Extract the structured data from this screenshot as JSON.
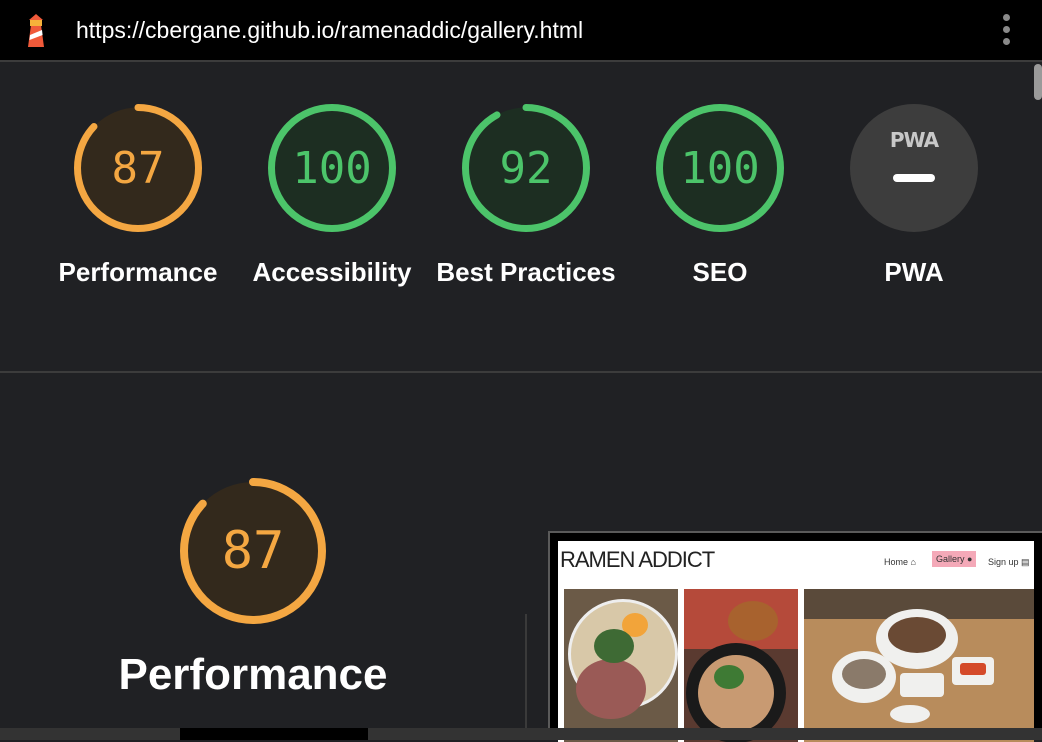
{
  "browser": {
    "url": "https://cbergane.github.io/ramenaddic/gallery.html",
    "logo_icon": "lighthouse-icon",
    "menu_icon": "kebab-menu-icon"
  },
  "colors": {
    "average": "#f4a742",
    "pass": "#4cc46a",
    "pwa_gray": "#3d3d3d",
    "background": "#202124"
  },
  "categories": [
    {
      "name": "Performance",
      "score": "87",
      "fraction": 0.87,
      "status": "average"
    },
    {
      "name": "Accessibility",
      "score": "100",
      "fraction": 1.0,
      "status": "pass"
    },
    {
      "name": "Best Practices",
      "score": "92",
      "fraction": 0.92,
      "status": "pass"
    },
    {
      "name": "SEO",
      "score": "100",
      "fraction": 1.0,
      "status": "pass"
    },
    {
      "name": "PWA",
      "badge": "PWA",
      "status": "na"
    }
  ],
  "performance_section": {
    "score": "87",
    "fraction": 0.87,
    "title": "Performance"
  },
  "screenshot_preview": {
    "site_title": "RAMEN ADDICT",
    "nav": [
      "Home",
      "Gallery",
      "Sign up"
    ],
    "active_nav": "Gallery"
  }
}
